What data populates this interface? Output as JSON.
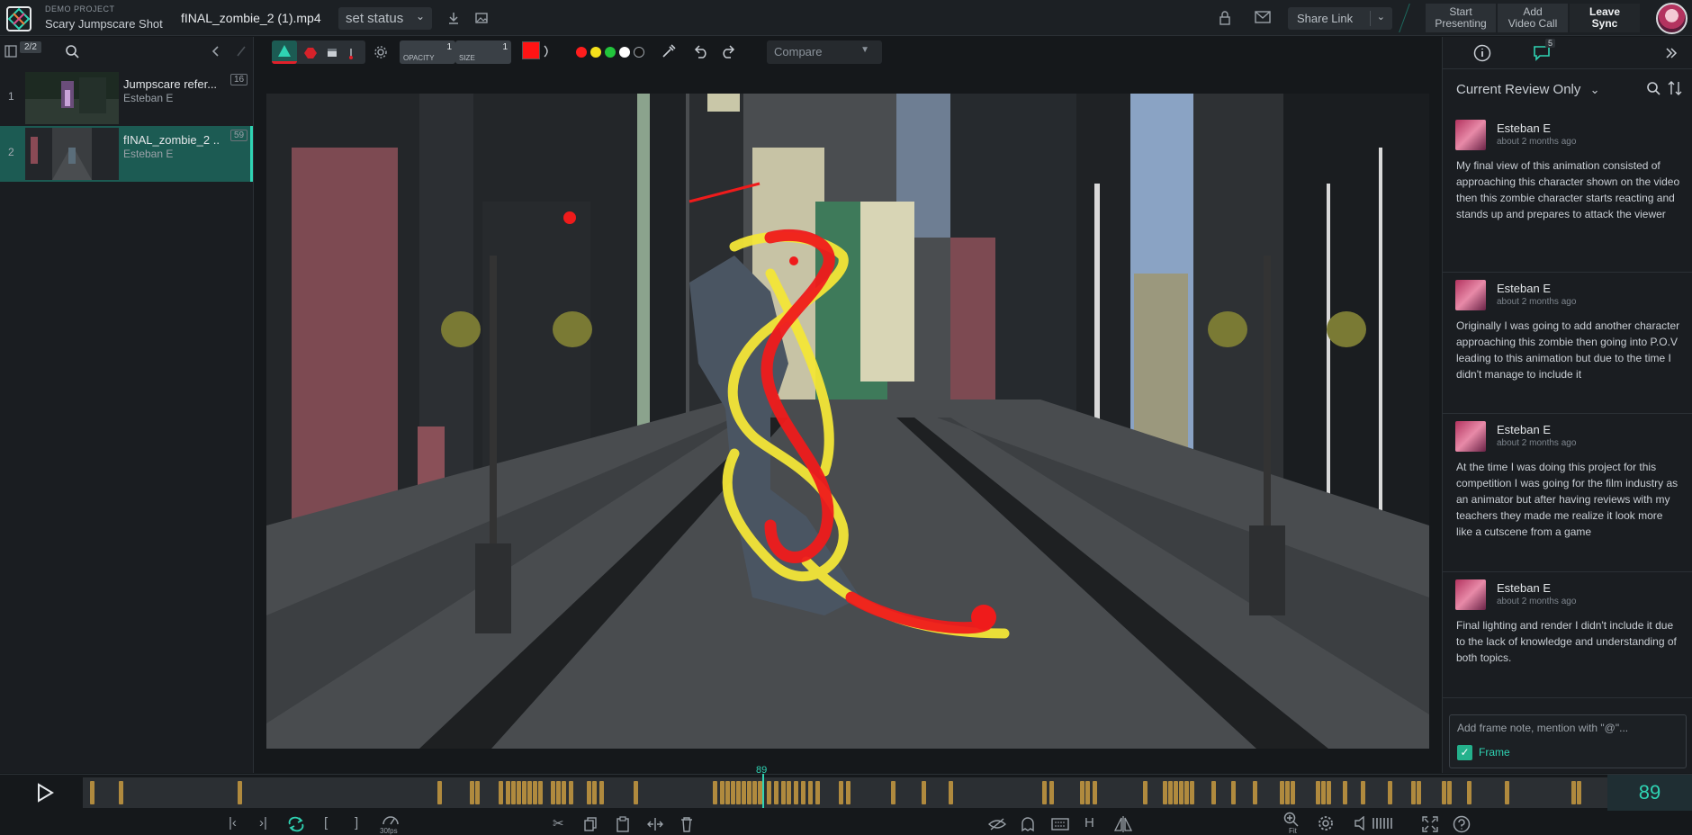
{
  "header": {
    "project_label": "DEMO PROJECT",
    "project_name": "Scary Jumpscare Shot",
    "file_name": "fINAL_zombie_2 (1).mp4",
    "status_label": "set status",
    "share_label": "Share Link",
    "start_presenting": [
      "Start",
      "Presenting"
    ],
    "add_video_call": [
      "Add",
      "Video Call"
    ],
    "leave_sync": [
      "Leave",
      "Sync"
    ]
  },
  "left_panel": {
    "counter": "2/2",
    "files": [
      {
        "index": "1",
        "title": "Jumpscare refer...",
        "author": "Esteban E",
        "count": "16"
      },
      {
        "index": "2",
        "title": "fINAL_zombie_2 ...",
        "author": "Esteban E",
        "count": "59"
      }
    ]
  },
  "toolbar": {
    "opacity_label": "OPACITY",
    "opacity_value": "1",
    "size_label": "SIZE",
    "size_value": "1",
    "compare_label": "Compare",
    "colors": [
      "#ff1d1d",
      "#f5e11b",
      "#22c53c",
      "#ffffff",
      "#111111"
    ],
    "accent": "#ff1414"
  },
  "right_panel": {
    "comments_badge": "5",
    "filter_label": "Current Review Only",
    "comments": [
      {
        "author": "Esteban E",
        "time": "about 2 months ago",
        "text": "My final view of this animation consisted of approaching this character shown on the video then this zombie character starts reacting and stands up and prepares to attack the viewer"
      },
      {
        "author": "Esteban E",
        "time": "about 2 months ago",
        "text": "Originally I was going to add another character approaching this zombie then going into P.O.V leading to this animation but due to the time I didn't manage to include it"
      },
      {
        "author": "Esteban E",
        "time": "about 2 months ago",
        "text": "At the time I was doing this project for this competition I was going for the film industry as an animator but after having reviews with my teachers they made me realize it look more like a cutscene from a game"
      },
      {
        "author": "Esteban E",
        "time": "about 2 months ago",
        "text": "Final lighting and render I didn't include it due to the lack of knowledge and understanding of both topics."
      }
    ],
    "note_placeholder": "Add frame note, mention with \"@\"...",
    "frame_label": "Frame"
  },
  "timeline": {
    "current_frame": "89",
    "fps_label": "30fps",
    "fit_label": "Fit",
    "accent": "#2fd3b3",
    "marker_color": "#b08a3e"
  }
}
